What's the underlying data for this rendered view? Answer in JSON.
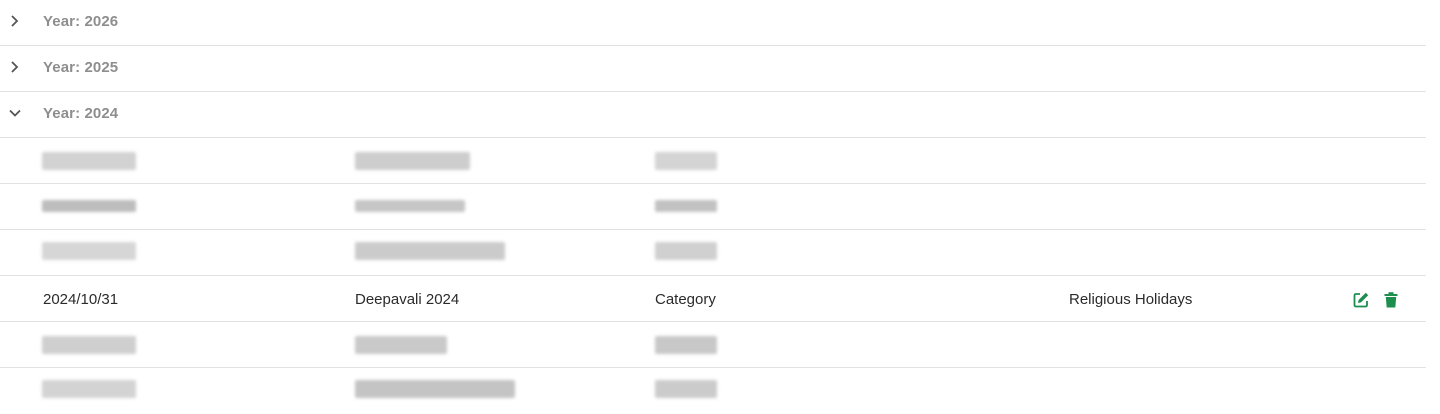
{
  "years": [
    {
      "label": "Year: 2026",
      "expanded": false
    },
    {
      "label": "Year: 2025",
      "expanded": false
    },
    {
      "label": "Year: 2024",
      "expanded": true
    }
  ],
  "visible_row": {
    "date": "2024/10/31",
    "name": "Deepavali 2024",
    "type": "Category",
    "category": "Religious Holidays"
  },
  "icons": {
    "collapsed": "chevron-right-icon",
    "expanded": "chevron-down-icon",
    "edit": "edit-icon",
    "delete": "trash-icon"
  },
  "colors": {
    "action": "#1e8e4e",
    "year_text": "#8e8e8e",
    "divider": "#e2e2e2"
  },
  "redacted_row_count": 5
}
